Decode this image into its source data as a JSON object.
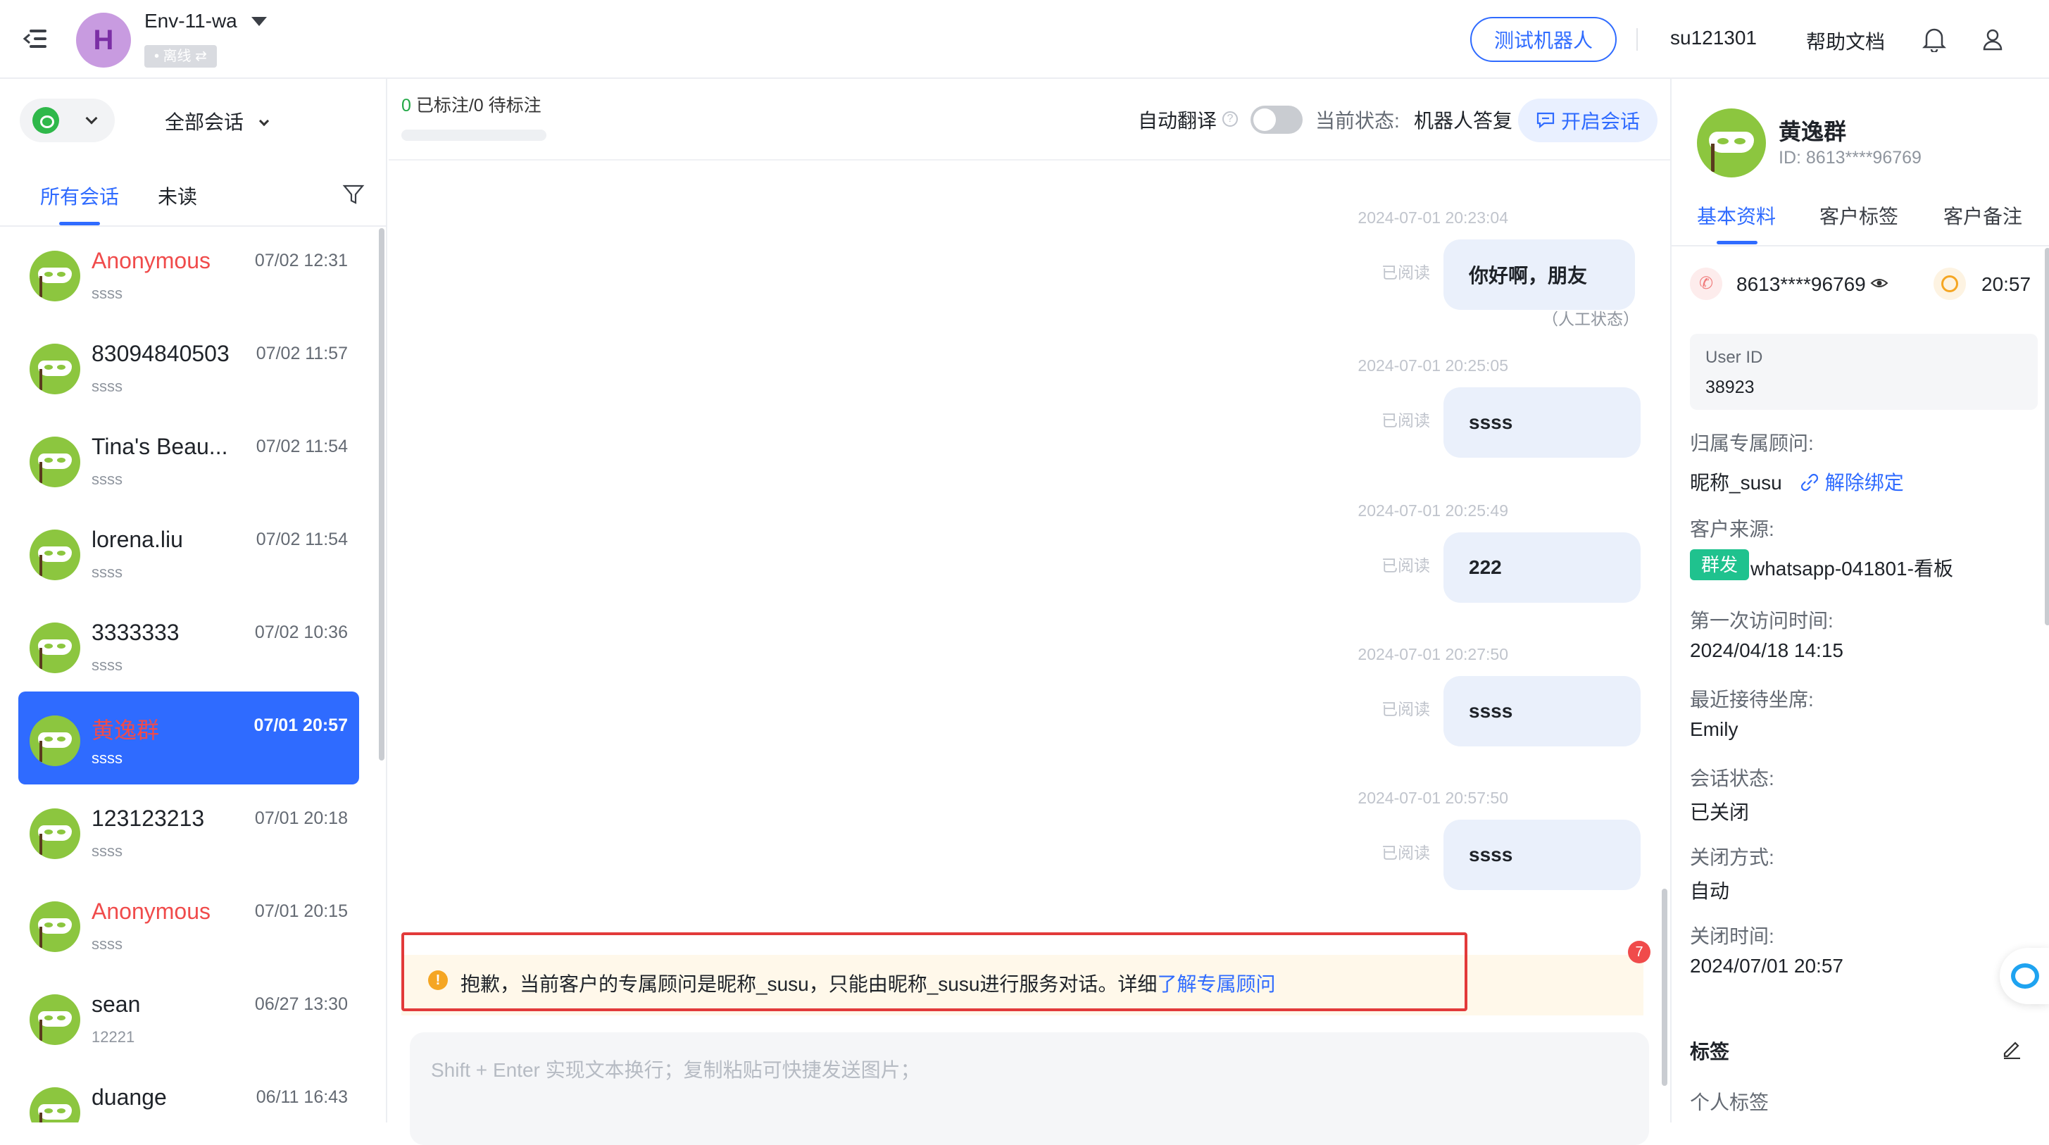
{
  "header": {
    "env_initial": "H",
    "env_name": "Env-11-wa",
    "env_status": "• 离线 ⇄",
    "test_bot_label": "测试机器人",
    "username": "su121301",
    "help_label": "帮助文档"
  },
  "left": {
    "channel": "whatsapp",
    "filter_label": "全部会话",
    "tabs": [
      "所有会话",
      "未读"
    ],
    "conversations": [
      {
        "name": "Anonymous",
        "time": "07/02 12:31",
        "preview": "ssss",
        "red": true,
        "selected": false
      },
      {
        "name": "83094840503",
        "time": "07/02 11:57",
        "preview": "ssss",
        "red": false,
        "selected": false
      },
      {
        "name": "Tina's Beau...",
        "time": "07/02 11:54",
        "preview": "ssss",
        "red": false,
        "selected": false
      },
      {
        "name": "lorena.liu",
        "time": "07/02 11:54",
        "preview": "ssss",
        "red": false,
        "selected": false
      },
      {
        "name": "3333333",
        "time": "07/02 10:36",
        "preview": "ssss",
        "red": false,
        "selected": false
      },
      {
        "name": "黄逸群",
        "time": "07/01 20:57",
        "preview": "ssss",
        "red": true,
        "selected": true
      },
      {
        "name": "123123213",
        "time": "07/01 20:18",
        "preview": "ssss",
        "red": false,
        "selected": false
      },
      {
        "name": "Anonymous",
        "time": "07/01 20:15",
        "preview": "ssss",
        "red": true,
        "selected": false
      },
      {
        "name": "sean",
        "time": "06/27 13:30",
        "preview": "12221",
        "red": false,
        "selected": false
      },
      {
        "name": "duange",
        "time": "06/11 16:43",
        "preview": "",
        "red": false,
        "selected": false
      }
    ]
  },
  "center": {
    "mark_count_green": "0",
    "mark_count_rest": " 已标注/0 待标注",
    "auto_translate_label": "自动翻译",
    "status_label": "当前状态:",
    "status_value": "机器人答复",
    "open_session_label": "开启会话",
    "read_label": "已阅读",
    "manual_note": "（人工状态）",
    "messages": [
      {
        "time": "2024-07-01 20:23:04",
        "text": "你好啊，朋友"
      },
      {
        "time": "2024-07-01 20:25:05",
        "text": "ssss"
      },
      {
        "time": "2024-07-01 20:25:49",
        "text": "222"
      },
      {
        "time": "2024-07-01 20:27:50",
        "text": "ssss"
      },
      {
        "time": "2024-07-01 20:57:50",
        "text": "ssss"
      }
    ],
    "warning_text": "抱歉，当前客户的专属顾问是昵称_susu，只能由昵称_susu进行服务对话。详细",
    "warning_link": "了解专属顾问",
    "input_placeholder": "Shift + Enter 实现文本换行；复制粘贴可快捷发送图片；"
  },
  "right": {
    "name": "黄逸群",
    "id_text": "ID: 8613****96769",
    "tabs": [
      "基本资料",
      "客户标签",
      "客户备注"
    ],
    "phone": "8613****96769",
    "clock_time": "20:57",
    "user_id_label": "User ID",
    "user_id": "38923",
    "advisor_label": "归属专属顾问:",
    "advisor": "昵称_susu",
    "unbind_label": "解除绑定",
    "source_label": "客户来源:",
    "source_tag": "群发",
    "source_value": "whatsapp-041801-看板",
    "first_visit_label": "第一次访问时间:",
    "first_visit": "2024/04/18 14:15",
    "last_agent_label": "最近接待坐席:",
    "last_agent": "Emily",
    "session_status_label": "会话状态:",
    "session_status": "已关闭",
    "close_method_label": "关闭方式:",
    "close_method": "自动",
    "close_time_label": "关闭时间:",
    "close_time": "2024/07/01 20:57",
    "tags_title": "标签",
    "personal_tag_label": "个人标签",
    "float_badge": "7"
  },
  "colors": {
    "accent": "#2f6bff",
    "warning_border": "#e23a3a",
    "source_tag": "#1fc28e",
    "avatar": "#8cc63f"
  }
}
